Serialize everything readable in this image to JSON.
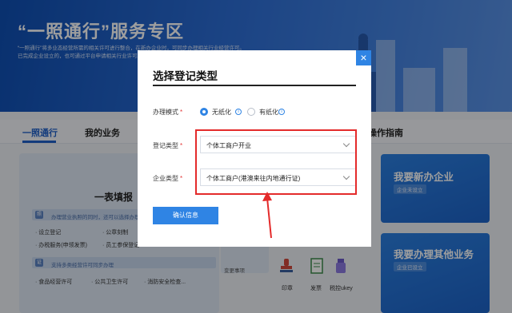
{
  "hero": {
    "title": "“一照通行”服务专区",
    "desc_line1": "“一照通行”将多业态经营所需的相关许可进行整合，在新办企业时，可同步办理相关行业经营许可。",
    "desc_line2": "已完成企业设立的，也可通过平台申请相关行业许可。"
  },
  "nav": {
    "tabs": [
      "一照通行",
      "我的业务"
    ],
    "guide": "操作指南"
  },
  "left_card": {
    "title": "一表填报",
    "strip1_badge": "照",
    "strip1_text": "办理营业执照的同时，还可以选择办理",
    "items1": [
      "· 设立登记",
      "· 公章刻制",
      "· 办税服务(申领发票)",
      "· 员工参保登记"
    ],
    "strip2_badge": "证",
    "strip2_text": "支持多类经营许可同步办理",
    "items2": [
      "· 食品经营许可",
      "· 公共卫生许可",
      "· 消防安全检查..."
    ]
  },
  "mid_card": {
    "text": "变更事项"
  },
  "tools": [
    "印章",
    "发票",
    "税控ukey"
  ],
  "blue_cards": [
    {
      "title": "我要新办企业",
      "tag": "企业未设立"
    },
    {
      "title": "我要办理其他业务",
      "tag": "企业已设立"
    }
  ],
  "modal": {
    "title": "选择登记类型",
    "close_label": "×",
    "mode_label": "办理模式",
    "mode_options": [
      "无纸化",
      "有纸化"
    ],
    "mode_selected": "无纸化",
    "reg_type_label": "登记类型",
    "reg_type_value": "个体工商户开业",
    "ent_type_label": "企业类型",
    "ent_type_value": "个体工商户(港澳来往内地通行证)",
    "required_mark": "*",
    "info_mark": "i",
    "confirm_label": "确认信息"
  },
  "colors": {
    "accent": "#2f84e4",
    "annotation": "#e42b2b",
    "hero_dark": "#0f4fb3"
  }
}
